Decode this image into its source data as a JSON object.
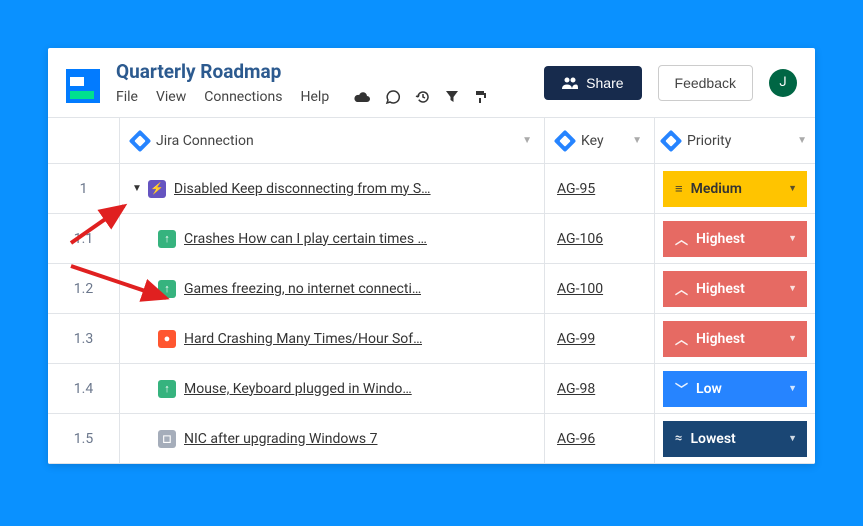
{
  "header": {
    "title": "Quarterly Roadmap",
    "menu": {
      "file": "File",
      "view": "View",
      "connections": "Connections",
      "help": "Help"
    },
    "share_label": "Share",
    "feedback_label": "Feedback",
    "avatar_initial": "J"
  },
  "columns": {
    "main": "Jira Connection",
    "key": "Key",
    "priority": "Priority"
  },
  "rows": [
    {
      "num": "1",
      "indent": 0,
      "expand": true,
      "type": "epic",
      "type_glyph": "⚡",
      "title": "Disabled Keep disconnecting from my S…",
      "key": "AG-95",
      "priority": "Medium",
      "pclass": "p-medium",
      "picon": "≡"
    },
    {
      "num": "1.1",
      "indent": 1,
      "expand": false,
      "type": "up",
      "type_glyph": "↑",
      "title": "Crashes How can I play certain times …",
      "key": "AG-106",
      "priority": "Highest",
      "pclass": "p-highest",
      "picon": "︿"
    },
    {
      "num": "1.2",
      "indent": 1,
      "expand": false,
      "type": "up",
      "type_glyph": "↑",
      "title": "Games freezing, no internet connecti…",
      "key": "AG-100",
      "priority": "Highest",
      "pclass": "p-highest",
      "picon": "︿"
    },
    {
      "num": "1.3",
      "indent": 1,
      "expand": false,
      "type": "bug",
      "type_glyph": "●",
      "title": "Hard Crashing Many Times/Hour Sof…",
      "key": "AG-99",
      "priority": "Highest",
      "pclass": "p-highest",
      "picon": "︿"
    },
    {
      "num": "1.4",
      "indent": 1,
      "expand": false,
      "type": "up",
      "type_glyph": "↑",
      "title": "Mouse, Keyboard plugged in Windo…",
      "key": "AG-98",
      "priority": "Low",
      "pclass": "p-low",
      "picon": "﹀"
    },
    {
      "num": "1.5",
      "indent": 1,
      "expand": false,
      "type": "gray",
      "type_glyph": "◻",
      "title": "NIC after upgrading Windows 7",
      "key": "AG-96",
      "priority": "Lowest",
      "pclass": "p-lowest",
      "picon": "≈"
    }
  ]
}
